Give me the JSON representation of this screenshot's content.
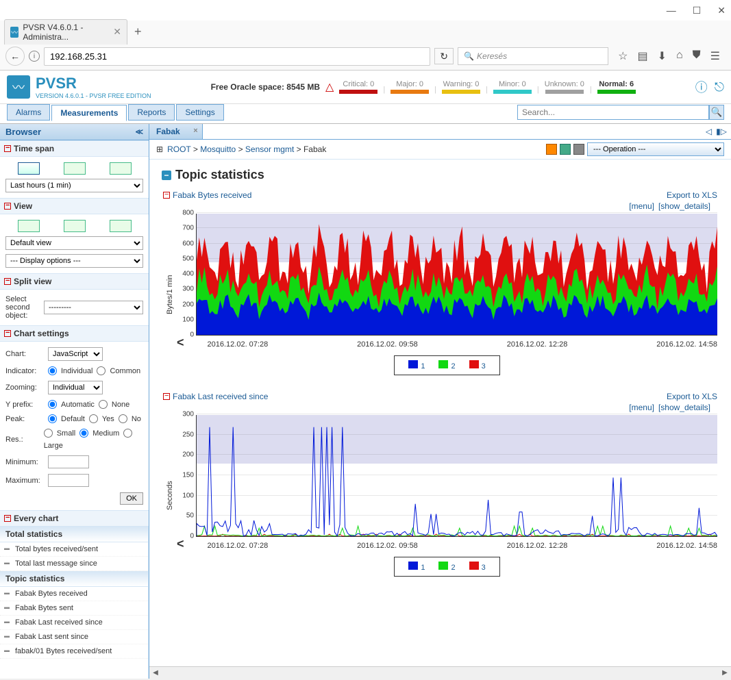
{
  "window": {
    "tab_title": "PVSR V4.6.0.1 - Administra...",
    "new_tab": "+"
  },
  "address_bar": {
    "url": "192.168.25.31",
    "search_placeholder": "Keresés"
  },
  "app": {
    "title": "PVSR",
    "subtitle": "VERSION 4.6.0.1 - PVSR FREE EDITION",
    "oracle_label": "Free Oracle space: 8545 MB"
  },
  "status": {
    "critical": {
      "label": "Critical: 0",
      "color": "#c01010"
    },
    "major": {
      "label": "Major: 0",
      "color": "#e87a10"
    },
    "warning": {
      "label": "Warning: 0",
      "color": "#e8c010"
    },
    "minor": {
      "label": "Minor: 0",
      "color": "#30c8c8"
    },
    "unknown": {
      "label": "Unknown: 0",
      "color": "#a0a0a0"
    },
    "normal": {
      "label": "Normal: 6",
      "color": "#10b010"
    }
  },
  "search_placeholder": "Search...",
  "tabs": {
    "alarms": "Alarms",
    "measurements": "Measurements",
    "reports": "Reports",
    "settings": "Settings"
  },
  "browser_panel": {
    "title": "Browser",
    "timespan_hdr": "Time span",
    "timespan_sel": "Last hours (1 min)",
    "view_hdr": "View",
    "view_sel": "Default view",
    "display_sel": "--- Display options ---",
    "splitview_hdr": "Split view",
    "split_label1": "Select",
    "split_label2": "second",
    "split_label3": "object:",
    "split_sel": "---------",
    "chartset_hdr": "Chart settings",
    "chart_label": "Chart:",
    "chart_sel": "JavaScript",
    "indicator_label": "Indicator:",
    "indicator_opts": [
      "Individual",
      "Common"
    ],
    "zooming_label": "Zooming:",
    "zooming_sel": "Individual",
    "yprefix_label": "Y prefix:",
    "yprefix_opts": [
      "Automatic",
      "None"
    ],
    "peak_label": "Peak:",
    "peak_opts": [
      "Default",
      "Yes",
      "No"
    ],
    "res_label": "Res.:",
    "res_opts": [
      "Small",
      "Medium",
      "Large"
    ],
    "min_label": "Minimum:",
    "max_label": "Maximum:",
    "ok": "OK",
    "every_hdr": "Every chart",
    "group1": "Total statistics",
    "items1": [
      "Total bytes received/sent",
      "Total last message since"
    ],
    "group2": "Topic statistics",
    "items2": [
      "Fabak Bytes received",
      "Fabak Bytes sent",
      "Fabak Last received since",
      "Fabak Last sent since",
      "fabak/01 Bytes received/sent"
    ]
  },
  "content": {
    "tab": "Fabak",
    "crumb_root": "ROOT",
    "crumb_1": "Mosquitto",
    "crumb_2": "Sensor mgmt",
    "crumb_3": "Fabak",
    "op_sel": "--- Operation ---",
    "section_hdr": "Topic statistics",
    "export_label": "Export to XLS",
    "menu_label": "[menu]",
    "details_label": "[show_details]"
  },
  "chart_data": [
    {
      "type": "area",
      "title": "Fabak Bytes received",
      "ylabel": "Bytes/1 min",
      "ylim": [
        0,
        800
      ],
      "yticks": [
        0,
        100,
        200,
        300,
        400,
        500,
        600,
        700,
        800
      ],
      "xticks": [
        "2016.12.02. 07:28",
        "2016.12.02. 09:58",
        "2016.12.02. 12:28",
        "2016.12.02. 14:58"
      ],
      "series": [
        {
          "name": "1",
          "color": "#0018d8",
          "baseline": 190
        },
        {
          "name": "2",
          "color": "#12d812",
          "baseline": 320
        },
        {
          "name": "3",
          "color": "#e01010",
          "baseline": 510
        }
      ]
    },
    {
      "type": "line",
      "title": "Fabak Last received since",
      "ylabel": "Seconds",
      "ylim": [
        0,
        300
      ],
      "yticks": [
        0,
        50,
        100,
        150,
        200,
        250,
        300
      ],
      "xticks": [
        "2016.12.02. 07:28",
        "2016.12.02. 09:58",
        "2016.12.02. 12:28",
        "2016.12.02. 14:58"
      ],
      "series": [
        {
          "name": "1",
          "color": "#0018d8",
          "spikes": [
            270,
            260,
            50,
            270,
            60,
            80,
            55,
            90,
            60,
            115,
            50,
            145,
            55,
            70
          ]
        },
        {
          "name": "2",
          "color": "#12d812",
          "spikes": [
            25,
            20,
            25,
            20,
            25,
            20,
            25,
            20,
            25,
            20,
            25,
            20,
            25,
            20
          ]
        },
        {
          "name": "3",
          "color": "#e01010",
          "spikes": [
            5,
            5,
            5,
            5,
            5,
            5,
            5,
            5,
            5,
            5,
            5,
            5,
            5,
            5
          ]
        }
      ]
    }
  ]
}
